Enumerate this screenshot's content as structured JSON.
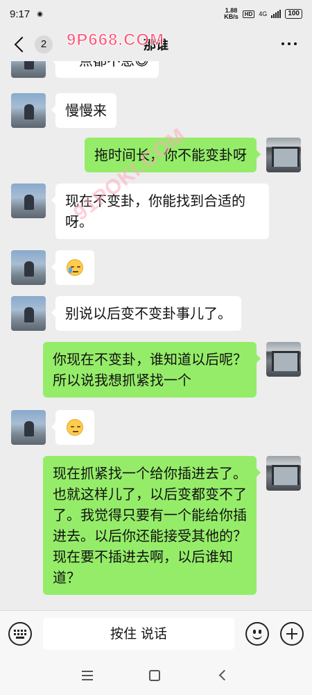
{
  "status_bar": {
    "time": "9:17",
    "speed_value": "1.88",
    "speed_unit": "KB/s",
    "hd": "HD",
    "network": "4G",
    "battery": "100"
  },
  "header": {
    "back_count": "2",
    "title": "那谁",
    "watermark": "9P668.COM"
  },
  "watermark_diagonal": "91POKI.COM",
  "messages": [
    {
      "side": "them",
      "type": "text",
      "text": "一点都不急😅"
    },
    {
      "side": "them",
      "type": "text",
      "text": "慢慢来"
    },
    {
      "side": "me",
      "type": "text",
      "text": "拖时间长，你不能变卦呀"
    },
    {
      "side": "them",
      "type": "text",
      "text": "现在不变卦，你能找到合适的呀。"
    },
    {
      "side": "them",
      "type": "emoji",
      "emoji": "crying-face-icon"
    },
    {
      "side": "them",
      "type": "text",
      "text": "别说以后变不变卦事儿了。"
    },
    {
      "side": "me",
      "type": "text",
      "text": "你现在不变卦，谁知道以后呢？所以说我想抓紧找一个"
    },
    {
      "side": "them",
      "type": "emoji",
      "emoji": "unamused-face-icon"
    },
    {
      "side": "me",
      "type": "text",
      "text": "现在抓紧找一个给你插进去了。也就这样儿了，以后变都变不了了。我觉得只要有一个能给你插进去。以后你还能接受其他的？现在要不插进去啊，以后谁知道？"
    }
  ],
  "input": {
    "talk_label": "按住 说话"
  },
  "colors": {
    "background": "#ededed",
    "my_bubble": "#95ec69",
    "their_bubble": "#ffffff"
  }
}
